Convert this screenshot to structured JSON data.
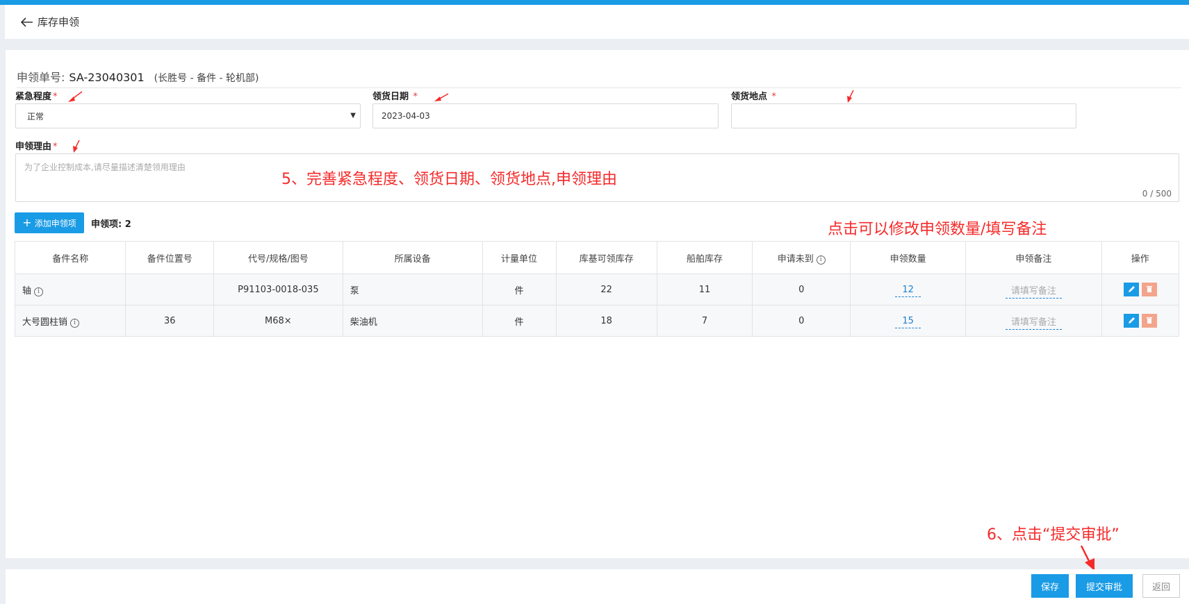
{
  "header": {
    "title": "库存申领"
  },
  "order": {
    "label": "申领单号:",
    "number": "SA-23040301",
    "sub": "(长胜号 - 备件 - 轮机部)"
  },
  "form": {
    "urgency": {
      "label": "紧急程度",
      "required": "*",
      "value": "正常"
    },
    "date": {
      "label": "领货日期",
      "required": "*",
      "value": "2023-04-03"
    },
    "location": {
      "label": "领货地点",
      "required": "*",
      "value": ""
    },
    "reason": {
      "label": "申领理由",
      "required": "*",
      "placeholder": "为了企业控制成本,请尽量描述清楚领用理由",
      "counter": "0 / 500"
    }
  },
  "toolbar": {
    "add_label": "添加申领项",
    "count_label": "申领项:",
    "count_value": "2"
  },
  "table": {
    "columns": [
      "备件名称",
      "备件位置号",
      "代号/规格/图号",
      "所属设备",
      "计量单位",
      "库基可领库存",
      "船舶库存",
      "申请未到",
      "申领数量",
      "申领备注",
      "操作"
    ],
    "rows": [
      {
        "name": "轴",
        "position": "",
        "code": "P91103-0018-035",
        "equipment": "泵",
        "unit": "件",
        "available": "22",
        "ship_stock": "11",
        "pending": "0",
        "qty": "12",
        "remark_placeholder": "请填写备注"
      },
      {
        "name": "大号圆柱销",
        "position": "36",
        "code": "M68×",
        "equipment": "柴油机",
        "unit": "件",
        "available": "18",
        "ship_stock": "7",
        "pending": "0",
        "qty": "15",
        "remark_placeholder": "请填写备注"
      }
    ]
  },
  "annotations": {
    "step5": "5、完善紧急程度、领货日期、领货地点,申领理由",
    "qty_hint": "点击可以修改申领数量/填写备注",
    "step6": "6、点击“提交审批”"
  },
  "footer": {
    "save_label": "保存",
    "submit_label": "提交审批",
    "back_label": "返回"
  },
  "colors": {
    "primary": "#1a9be5",
    "annotation": "#f52a2a",
    "required": "#e4393c",
    "delete": "#f3a58c"
  }
}
